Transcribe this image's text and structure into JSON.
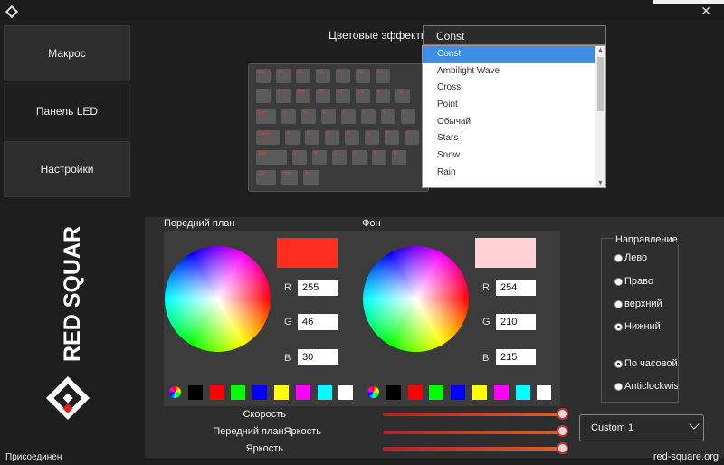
{
  "sidebar": {
    "items": [
      {
        "label": "Макрос"
      },
      {
        "label": "Панель LED"
      },
      {
        "label": "Настройки"
      }
    ]
  },
  "brand": {
    "name": "RED SQUARE"
  },
  "effects": {
    "label": "Цветовые эффекты",
    "selected": "Const",
    "options": [
      "Const",
      "Ambilight Wave",
      "Cross",
      "Point",
      "Обычай",
      "Stars",
      "Snow",
      "Rain"
    ]
  },
  "keyboard": {
    "keys": [
      "Esc",
      "F1",
      "F2",
      "F3",
      "F4",
      "F5",
      "F6",
      "~",
      "1!",
      "2@",
      "3#",
      "4$",
      "5%",
      "6^",
      "7&",
      "Tab",
      "Q",
      "W",
      "E",
      "R",
      "T",
      "Y",
      "U",
      "Caps",
      "A",
      "S",
      "D",
      "F",
      "G",
      "H",
      "J",
      "Shift",
      "Z",
      "X",
      "C",
      "V",
      "B",
      "N",
      "Ctrl",
      "Win",
      "Alt"
    ]
  },
  "foreground": {
    "title": "Передний план",
    "color": "#ff2e1e",
    "r": "255",
    "g": "46",
    "b": "30"
  },
  "background": {
    "title": "Фон",
    "color": "#fed2d7",
    "r": "254",
    "g": "210",
    "b": "215"
  },
  "rgb_labels": {
    "r": "R",
    "g": "G",
    "b": "B"
  },
  "swatches": [
    "#000000",
    "#ff0000",
    "#00ff00",
    "#0000ff",
    "#ffff00",
    "#ff00ff",
    "#00ffff",
    "#ffffff"
  ],
  "direction": {
    "title": "Направление",
    "options": [
      {
        "label": "Лево",
        "checked": false
      },
      {
        "label": "Право",
        "checked": false
      },
      {
        "label": "верхний",
        "checked": false
      },
      {
        "label": "Нижний",
        "checked": true
      }
    ],
    "rotation": [
      {
        "label": "По часовой",
        "checked": true
      },
      {
        "label": "Anticlockwise",
        "checked": false
      }
    ]
  },
  "sliders": [
    {
      "label": "Скорость",
      "value": 1.0
    },
    {
      "label": "Передний планЯркость",
      "value": 1.0
    },
    {
      "label": "Яркость",
      "value": 1.0
    }
  ],
  "profile": {
    "selected": "Custom 1"
  },
  "status": "Присоединен",
  "site": "red-square.org"
}
